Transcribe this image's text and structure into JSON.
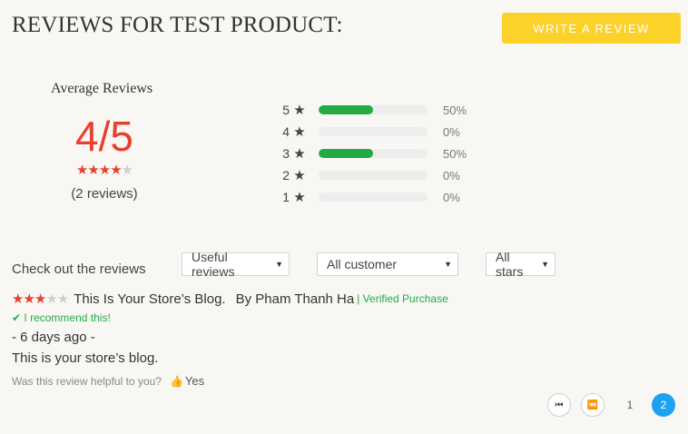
{
  "header": {
    "title": "Reviews for Test Product:",
    "write_review_label": "WRITE A REVIEW"
  },
  "summary": {
    "label": "Average Reviews",
    "score": "4/5",
    "rating": 4,
    "count_text": "(2 reviews)"
  },
  "distribution": [
    {
      "stars": "5",
      "percent": "50%",
      "fraction": 0.5
    },
    {
      "stars": "4",
      "percent": "0%",
      "fraction": 0
    },
    {
      "stars": "3",
      "percent": "50%",
      "fraction": 0.5
    },
    {
      "stars": "2",
      "percent": "0%",
      "fraction": 0
    },
    {
      "stars": "1",
      "percent": "0%",
      "fraction": 0
    }
  ],
  "filters": {
    "label": "Check out the reviews",
    "sort_value": "Useful reviews",
    "customer_value": "All customer",
    "stars_value": "All stars"
  },
  "review": {
    "rating": 3,
    "title": "This Is Your Store’s Blog.",
    "author": "By Pham Thanh Ha",
    "verified": "| Verified Purchase",
    "recommend": "I recommend this!",
    "date": "- 6 days ago -",
    "body": "This is your store’s blog.",
    "helpful_question": "Was this review helpful to you?",
    "yes_label": "Yes"
  },
  "pagination": {
    "pages": [
      "1",
      "2"
    ],
    "current": "2"
  },
  "icons": {
    "star": "star-icon",
    "check": "check-icon",
    "thumb": "thumbs-up-icon",
    "first": "first-page-icon",
    "prev": "previous-page-icon",
    "caret": "caret-down-icon"
  },
  "colors": {
    "accent_yellow": "#fcd12a",
    "star_red": "#e8402c",
    "bar_green": "#22ab45",
    "page_active": "#1da1f2"
  }
}
